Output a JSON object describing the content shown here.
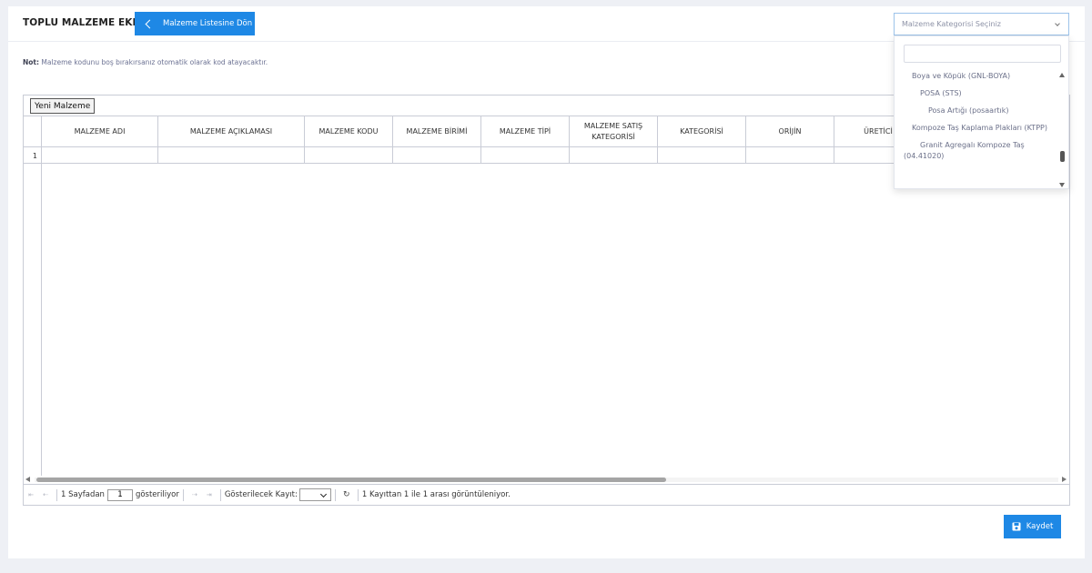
{
  "header": {
    "title": "TOPLU MALZEME EKLEME",
    "back_label": "Malzeme Listesine Dön"
  },
  "note": {
    "label": "Not:",
    "text": "Malzeme kodunu boş bırakırsanız otomatik olarak kod atayacaktır."
  },
  "grid": {
    "new_button": "Yeni Malzeme",
    "columns": [
      "",
      "MALZEME ADI",
      "MALZEME AÇIKLAMASI",
      "MALZEME KODU",
      "MALZEME BİRİMİ",
      "MALZEME TİPİ",
      "MALZEME SATIŞ KATEGORİSİ",
      "KATEGORİSİ",
      "ORİJİN",
      "ÜRETİCİ"
    ],
    "rows": [
      {
        "num": "1"
      }
    ]
  },
  "pager": {
    "first_icon": "first-page-icon",
    "prev_icon": "prev-page-icon",
    "page_prefix": "1 Sayfadan",
    "page_value": "1",
    "page_suffix": "gösteriliyor",
    "next_icon": "next-page-icon",
    "last_icon": "last-page-icon",
    "page_size_label": "Gösterilecek Kayıt:",
    "refresh_icon": "refresh-icon",
    "summary": "1 Kayıttan 1 ile 1 arası görüntüleniyor."
  },
  "save_button": {
    "label": "Kaydet",
    "icon": "floppy-disk-icon"
  },
  "category_select": {
    "placeholder": "Malzeme Kategorisi Seçiniz",
    "options": [
      {
        "label": "Boya ve Köpük (GNL-BOYA)",
        "level": 1
      },
      {
        "label": "POSA (STS)",
        "level": 2
      },
      {
        "label": "Posa Artığı (posaartık)",
        "level": 3
      },
      {
        "label": "Kompoze Taş Kaplama Plakları (KTPP)",
        "level": 1
      },
      {
        "label": "Granit Agregalı Kompoze Taş (04.41020)",
        "level": 2
      }
    ]
  },
  "colors": {
    "primary": "#1e88e5",
    "background": "#eef0f5",
    "border": "#c9ccd6",
    "select_border": "#9cc3ea"
  }
}
